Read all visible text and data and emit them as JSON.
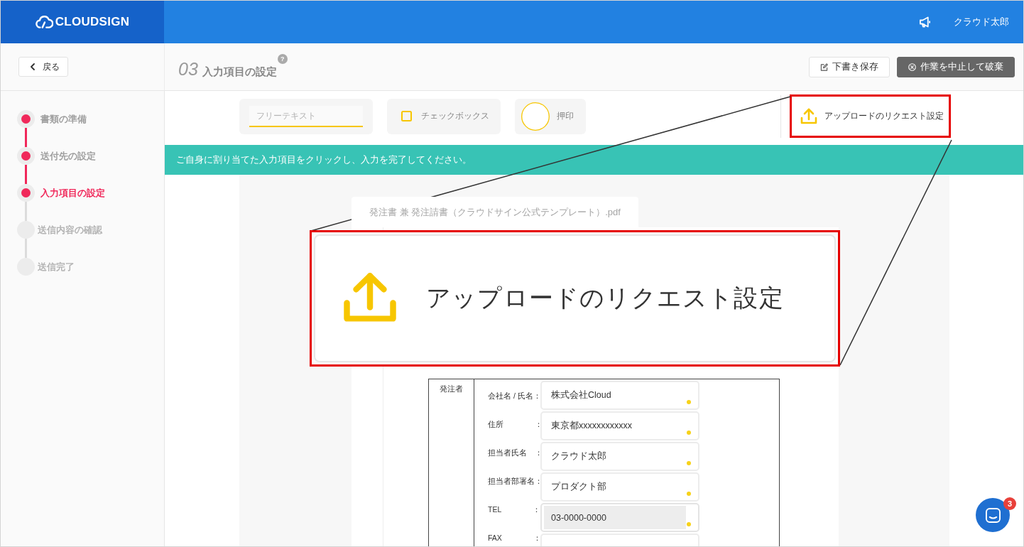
{
  "header": {
    "logo": "CLOUDSIGN",
    "user_name": "クラウド太郎"
  },
  "page_header": {
    "back_button": "戻る",
    "step_number": "03",
    "title": "入力項目の設定",
    "help_mark": "?",
    "buttons": [
      {
        "label": "下書き保存",
        "kind": "draft"
      },
      {
        "label": "作業を中止して破棄",
        "kind": "discard"
      }
    ]
  },
  "steps": [
    {
      "label": "書類の準備",
      "done": true,
      "selected": false
    },
    {
      "label": "送付先の設定",
      "done": true,
      "selected": false
    },
    {
      "label": "入力項目の設定",
      "done": true,
      "selected": true
    },
    {
      "label": "送信内容の確認",
      "done": false,
      "selected": false
    },
    {
      "label": "送信完了",
      "done": false,
      "selected": false
    }
  ],
  "tools": [
    {
      "kind": "text",
      "placeholder": "フリーテキスト",
      "highlighted": false
    },
    {
      "kind": "checkbox",
      "label": "チェックボックス",
      "highlighted": false
    },
    {
      "kind": "stamp",
      "label": "押印",
      "highlighted": false
    },
    {
      "kind": "upload",
      "label": "アップロードのリクエスト設定",
      "highlighted": true
    }
  ],
  "banner": "ご自身に割り当てた入力項目をクリックし、入力を完了してください。",
  "document": {
    "tab": "発注書 兼 発注請書（クラウドサイン公式テンプレート）.pdf",
    "party_label": "発注者",
    "fields": [
      {
        "label": "会社名 / 氏名：",
        "value": "株式会社Cloud",
        "hovered": false
      },
      {
        "label": "住所　　　　：",
        "value": "東京都xxxxxxxxxxxx",
        "hovered": false
      },
      {
        "label": "担当者氏名　：",
        "value": "クラウド太郎",
        "hovered": false
      },
      {
        "label": "担当者部署名：",
        "value": "プロダクト部",
        "hovered": false
      },
      {
        "label": "TEL　　　　：",
        "value": "03-0000-0000",
        "hovered": true
      },
      {
        "label": "FAX　　　　：",
        "hovered": false
      }
    ]
  },
  "callout": {
    "label": "アップロードのリクエスト設定"
  },
  "chat": {
    "badge": "3"
  }
}
